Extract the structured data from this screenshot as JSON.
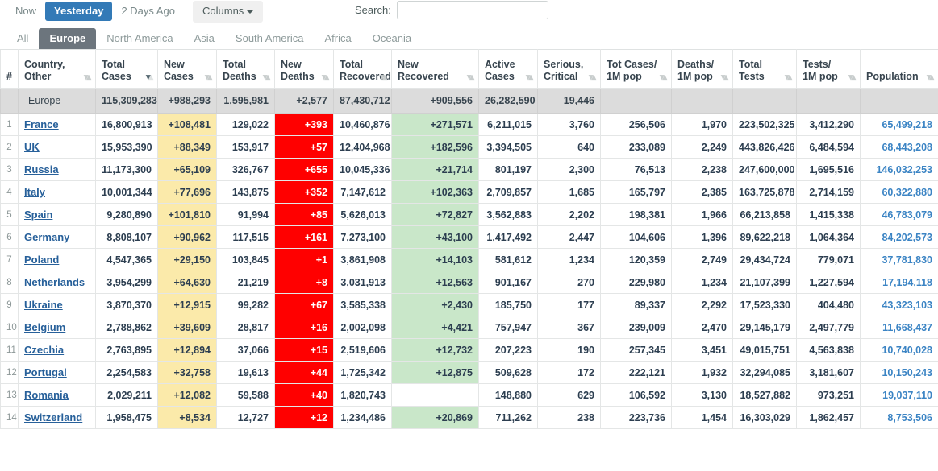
{
  "toolbar": {
    "time_tabs": [
      {
        "label": "Now",
        "active": false
      },
      {
        "label": "Yesterday",
        "active": true
      },
      {
        "label": "2 Days Ago",
        "active": false
      }
    ],
    "columns_button": "Columns",
    "caret_icon": "caret-down-icon",
    "search_label": "Search:",
    "search_value": "",
    "search_placeholder": ""
  },
  "continent_tabs": [
    {
      "label": "All",
      "active": false
    },
    {
      "label": "Europe",
      "active": true
    },
    {
      "label": "North America",
      "active": false
    },
    {
      "label": "Asia",
      "active": false
    },
    {
      "label": "South America",
      "active": false
    },
    {
      "label": "Africa",
      "active": false
    },
    {
      "label": "Oceania",
      "active": false
    }
  ],
  "table": {
    "headers": [
      {
        "line1": "#",
        "line2": "",
        "sort": "none"
      },
      {
        "line1": "Country,",
        "line2": "Other",
        "sort": "none"
      },
      {
        "line1": "Total",
        "line2": "Cases",
        "sort": "desc"
      },
      {
        "line1": "New",
        "line2": "Cases",
        "sort": "none"
      },
      {
        "line1": "Total",
        "line2": "Deaths",
        "sort": "none"
      },
      {
        "line1": "New",
        "line2": "Deaths",
        "sort": "none"
      },
      {
        "line1": "Total",
        "line2": "Recovered",
        "sort": "none"
      },
      {
        "line1": "New",
        "line2": "Recovered",
        "sort": "none"
      },
      {
        "line1": "Active",
        "line2": "Cases",
        "sort": "none"
      },
      {
        "line1": "Serious,",
        "line2": "Critical",
        "sort": "none"
      },
      {
        "line1": "Tot Cases/",
        "line2": "1M pop",
        "sort": "none"
      },
      {
        "line1": "Deaths/",
        "line2": "1M pop",
        "sort": "none"
      },
      {
        "line1": "Total",
        "line2": "Tests",
        "sort": "none"
      },
      {
        "line1": "Tests/",
        "line2": "1M pop",
        "sort": "none"
      },
      {
        "line1": "Population",
        "line2": "",
        "sort": "none"
      }
    ],
    "summary": {
      "rank": "",
      "country": "Europe",
      "total_cases": "115,309,283",
      "new_cases": "+988,293",
      "total_deaths": "1,595,981",
      "new_deaths": "+2,577",
      "total_recovered": "87,430,712",
      "new_recovered": "+909,556",
      "active_cases": "26,282,590",
      "serious_critical": "19,446",
      "tot_cases_1m": "",
      "deaths_1m": "",
      "total_tests": "",
      "tests_1m": "",
      "population": ""
    },
    "rows": [
      {
        "rank": "1",
        "country": "France",
        "total_cases": "16,800,913",
        "new_cases": "+108,481",
        "total_deaths": "129,022",
        "new_deaths": "+393",
        "total_recovered": "10,460,876",
        "new_recovered": "+271,571",
        "active_cases": "6,211,015",
        "serious_critical": "3,760",
        "tot_cases_1m": "256,506",
        "deaths_1m": "1,970",
        "total_tests": "223,502,325",
        "tests_1m": "3,412,290",
        "population": "65,499,218"
      },
      {
        "rank": "2",
        "country": "UK",
        "total_cases": "15,953,390",
        "new_cases": "+88,349",
        "total_deaths": "153,917",
        "new_deaths": "+57",
        "total_recovered": "12,404,968",
        "new_recovered": "+182,596",
        "active_cases": "3,394,505",
        "serious_critical": "640",
        "tot_cases_1m": "233,089",
        "deaths_1m": "2,249",
        "total_tests": "443,826,426",
        "tests_1m": "6,484,594",
        "population": "68,443,208"
      },
      {
        "rank": "3",
        "country": "Russia",
        "total_cases": "11,173,300",
        "new_cases": "+65,109",
        "total_deaths": "326,767",
        "new_deaths": "+655",
        "total_recovered": "10,045,336",
        "new_recovered": "+21,714",
        "active_cases": "801,197",
        "serious_critical": "2,300",
        "tot_cases_1m": "76,513",
        "deaths_1m": "2,238",
        "total_tests": "247,600,000",
        "tests_1m": "1,695,516",
        "population": "146,032,253"
      },
      {
        "rank": "4",
        "country": "Italy",
        "total_cases": "10,001,344",
        "new_cases": "+77,696",
        "total_deaths": "143,875",
        "new_deaths": "+352",
        "total_recovered": "7,147,612",
        "new_recovered": "+102,363",
        "active_cases": "2,709,857",
        "serious_critical": "1,685",
        "tot_cases_1m": "165,797",
        "deaths_1m": "2,385",
        "total_tests": "163,725,878",
        "tests_1m": "2,714,159",
        "population": "60,322,880"
      },
      {
        "rank": "5",
        "country": "Spain",
        "total_cases": "9,280,890",
        "new_cases": "+101,810",
        "total_deaths": "91,994",
        "new_deaths": "+85",
        "total_recovered": "5,626,013",
        "new_recovered": "+72,827",
        "active_cases": "3,562,883",
        "serious_critical": "2,202",
        "tot_cases_1m": "198,381",
        "deaths_1m": "1,966",
        "total_tests": "66,213,858",
        "tests_1m": "1,415,338",
        "population": "46,783,079"
      },
      {
        "rank": "6",
        "country": "Germany",
        "total_cases": "8,808,107",
        "new_cases": "+90,962",
        "total_deaths": "117,515",
        "new_deaths": "+161",
        "total_recovered": "7,273,100",
        "new_recovered": "+43,100",
        "active_cases": "1,417,492",
        "serious_critical": "2,447",
        "tot_cases_1m": "104,606",
        "deaths_1m": "1,396",
        "total_tests": "89,622,218",
        "tests_1m": "1,064,364",
        "population": "84,202,573"
      },
      {
        "rank": "7",
        "country": "Poland",
        "total_cases": "4,547,365",
        "new_cases": "+29,150",
        "total_deaths": "103,845",
        "new_deaths": "+1",
        "total_recovered": "3,861,908",
        "new_recovered": "+14,103",
        "active_cases": "581,612",
        "serious_critical": "1,234",
        "tot_cases_1m": "120,359",
        "deaths_1m": "2,749",
        "total_tests": "29,434,724",
        "tests_1m": "779,071",
        "population": "37,781,830"
      },
      {
        "rank": "8",
        "country": "Netherlands",
        "total_cases": "3,954,299",
        "new_cases": "+64,630",
        "total_deaths": "21,219",
        "new_deaths": "+8",
        "total_recovered": "3,031,913",
        "new_recovered": "+12,563",
        "active_cases": "901,167",
        "serious_critical": "270",
        "tot_cases_1m": "229,980",
        "deaths_1m": "1,234",
        "total_tests": "21,107,399",
        "tests_1m": "1,227,594",
        "population": "17,194,118"
      },
      {
        "rank": "9",
        "country": "Ukraine",
        "total_cases": "3,870,370",
        "new_cases": "+12,915",
        "total_deaths": "99,282",
        "new_deaths": "+67",
        "total_recovered": "3,585,338",
        "new_recovered": "+2,430",
        "active_cases": "185,750",
        "serious_critical": "177",
        "tot_cases_1m": "89,337",
        "deaths_1m": "2,292",
        "total_tests": "17,523,330",
        "tests_1m": "404,480",
        "population": "43,323,103"
      },
      {
        "rank": "10",
        "country": "Belgium",
        "total_cases": "2,788,862",
        "new_cases": "+39,609",
        "total_deaths": "28,817",
        "new_deaths": "+16",
        "total_recovered": "2,002,098",
        "new_recovered": "+4,421",
        "active_cases": "757,947",
        "serious_critical": "367",
        "tot_cases_1m": "239,009",
        "deaths_1m": "2,470",
        "total_tests": "29,145,179",
        "tests_1m": "2,497,779",
        "population": "11,668,437"
      },
      {
        "rank": "11",
        "country": "Czechia",
        "total_cases": "2,763,895",
        "new_cases": "+12,894",
        "total_deaths": "37,066",
        "new_deaths": "+15",
        "total_recovered": "2,519,606",
        "new_recovered": "+12,732",
        "active_cases": "207,223",
        "serious_critical": "190",
        "tot_cases_1m": "257,345",
        "deaths_1m": "3,451",
        "total_tests": "49,015,751",
        "tests_1m": "4,563,838",
        "population": "10,740,028"
      },
      {
        "rank": "12",
        "country": "Portugal",
        "total_cases": "2,254,583",
        "new_cases": "+32,758",
        "total_deaths": "19,613",
        "new_deaths": "+44",
        "total_recovered": "1,725,342",
        "new_recovered": "+12,875",
        "active_cases": "509,628",
        "serious_critical": "172",
        "tot_cases_1m": "222,121",
        "deaths_1m": "1,932",
        "total_tests": "32,294,085",
        "tests_1m": "3,181,607",
        "population": "10,150,243"
      },
      {
        "rank": "13",
        "country": "Romania",
        "total_cases": "2,029,211",
        "new_cases": "+12,082",
        "total_deaths": "59,588",
        "new_deaths": "+40",
        "total_recovered": "1,820,743",
        "new_recovered": "",
        "active_cases": "148,880",
        "serious_critical": "629",
        "tot_cases_1m": "106,592",
        "deaths_1m": "3,130",
        "total_tests": "18,527,882",
        "tests_1m": "973,251",
        "population": "19,037,110"
      },
      {
        "rank": "14",
        "country": "Switzerland",
        "total_cases": "1,958,475",
        "new_cases": "+8,534",
        "total_deaths": "12,727",
        "new_deaths": "+12",
        "total_recovered": "1,234,486",
        "new_recovered": "+20,869",
        "active_cases": "711,262",
        "serious_critical": "238",
        "tot_cases_1m": "223,736",
        "deaths_1m": "1,454",
        "total_tests": "16,303,029",
        "tests_1m": "1,862,457",
        "population": "8,753,506"
      }
    ]
  },
  "colors": {
    "active_tab_blue": "#337ab7",
    "active_continent_gray": "#6c757d",
    "new_cases_yellow": "#fbeaaa",
    "new_deaths_red": "#ff0000",
    "new_recovered_green": "#c9e7c9",
    "link_blue": "#27609a",
    "population_blue": "#3b84c4"
  }
}
